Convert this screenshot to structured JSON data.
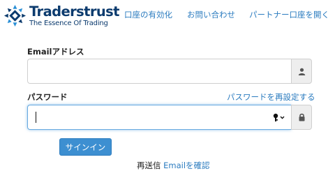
{
  "brand": {
    "name": "Traderstrust",
    "tagline": "The Essence Of Trading",
    "color": "#0c3b6e"
  },
  "nav": {
    "activate_account": "口座の有効化",
    "contact": "お問い合わせ",
    "partner_account": "パートナー口座を開く"
  },
  "form": {
    "email": {
      "label": "Emailアドレス",
      "value": "",
      "icon": "user-icon"
    },
    "password": {
      "label": "パスワード",
      "value": "",
      "icon": "lock-icon",
      "reset_link": "パスワードを再設定する"
    },
    "signin_button": "サインイン",
    "resend": {
      "text": "再送信",
      "link": "Emailを確認"
    }
  },
  "colors": {
    "link": "#2a7bbf",
    "button": "#3d8fd1",
    "focus": "#66a9e0"
  }
}
